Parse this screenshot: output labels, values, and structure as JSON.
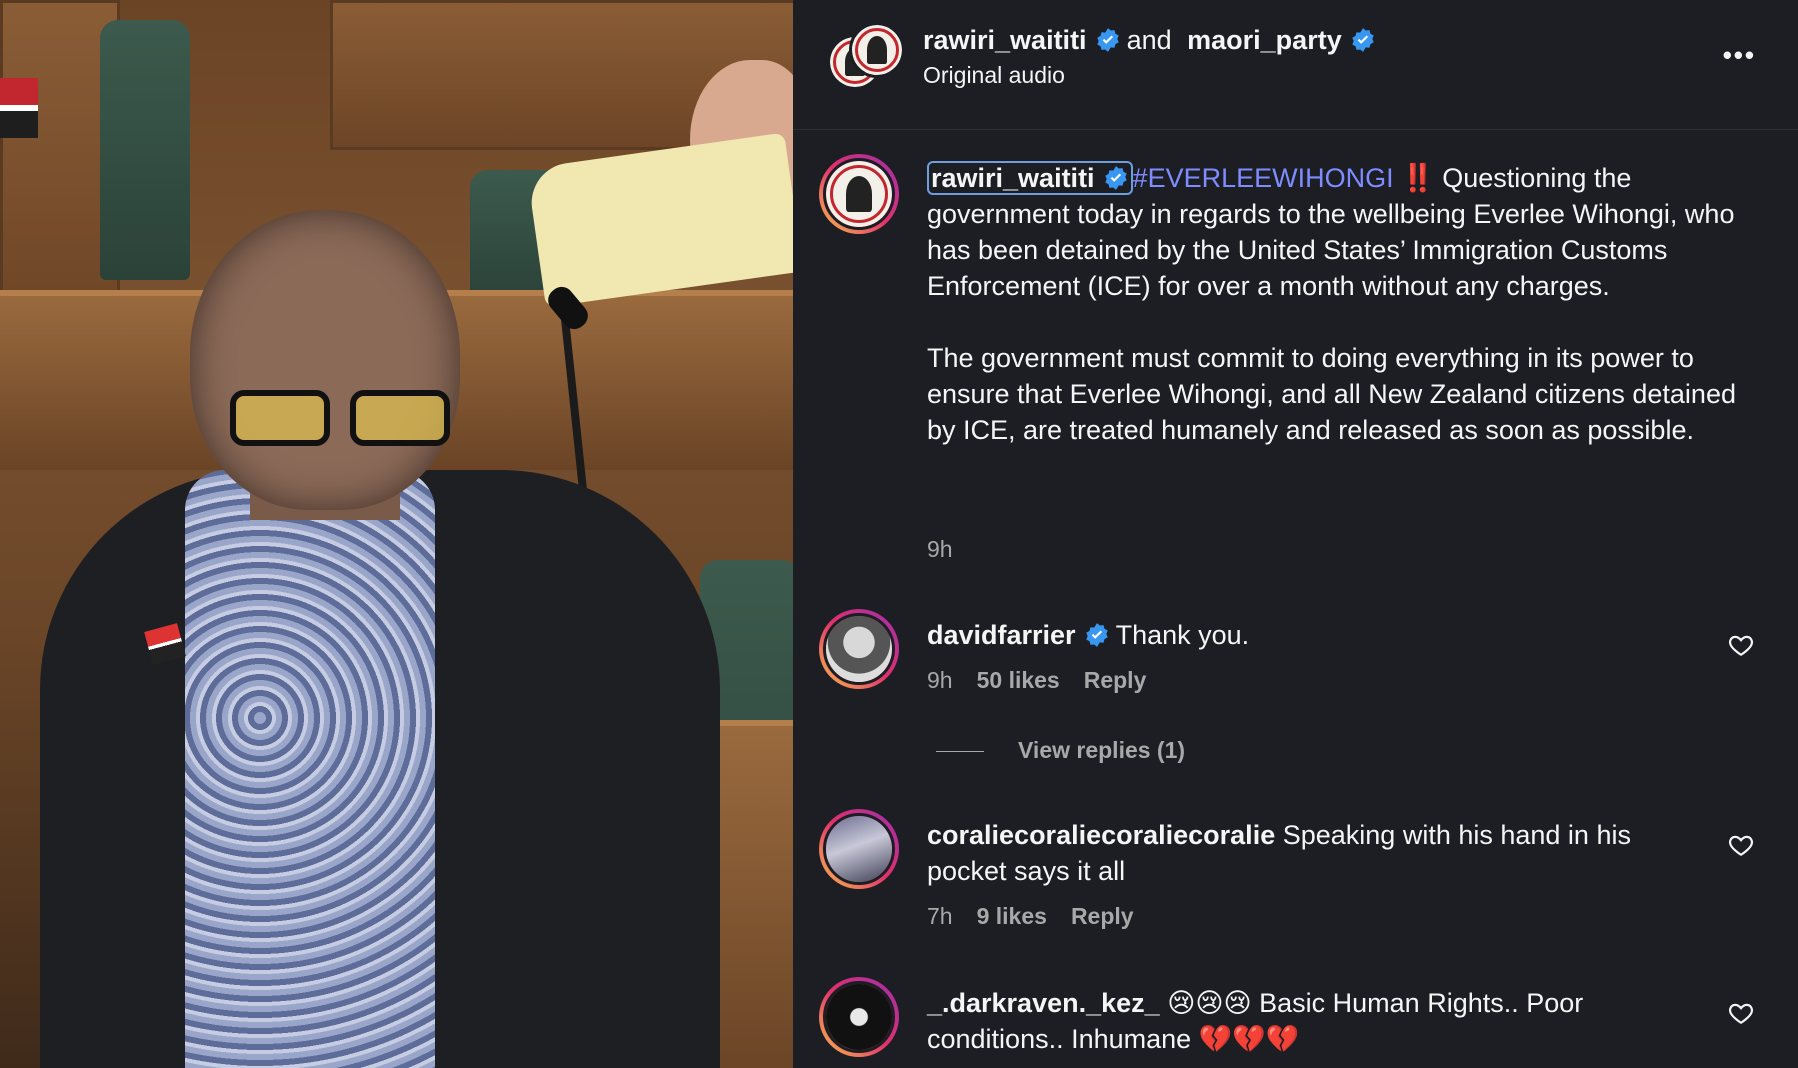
{
  "header": {
    "user1": "rawiri_waititi",
    "and_text": "and",
    "user2": "maori_party",
    "subtitle": "Original audio",
    "more_label": "•••"
  },
  "post": {
    "caption_user": "rawiri_waititi",
    "hashtag": "#EVERLEEWIHONGI",
    "bang": "‼️",
    "paragraph1": " Questioning the government today in regards to the wellbeing Everlee Wihongi, who has been detained by the United States’ Immigration Customs Enforcement (ICE) for over a month without any charges.",
    "paragraph2": "The government must commit to doing everything in its power to ensure that Everlee Wihongi, and all New Zealand citizens detained by ICE, are treated humanely and released as soon as possible.",
    "time": "9h"
  },
  "comments": [
    {
      "username": "davidfarrier",
      "verified": true,
      "text": "Thank you.",
      "time": "9h",
      "likes": "50 likes",
      "reply": "Reply",
      "view_replies": "View replies (1)"
    },
    {
      "username": "coraliecoraliecoraliecoralie",
      "verified": false,
      "text": "Speaking with his hand in his pocket says it all",
      "time": "7h",
      "likes": "9 likes",
      "reply": "Reply"
    },
    {
      "username": "_.darkraven._kez_",
      "verified": false,
      "text": "😢😢😢 Basic Human Rights.. Poor conditions.. Inhumane 💔💔💔"
    }
  ],
  "colors": {
    "background": "#1c1e24",
    "verified_blue": "#3897f0",
    "hashtag": "#7e8cff",
    "muted": "#a8a8a8"
  }
}
